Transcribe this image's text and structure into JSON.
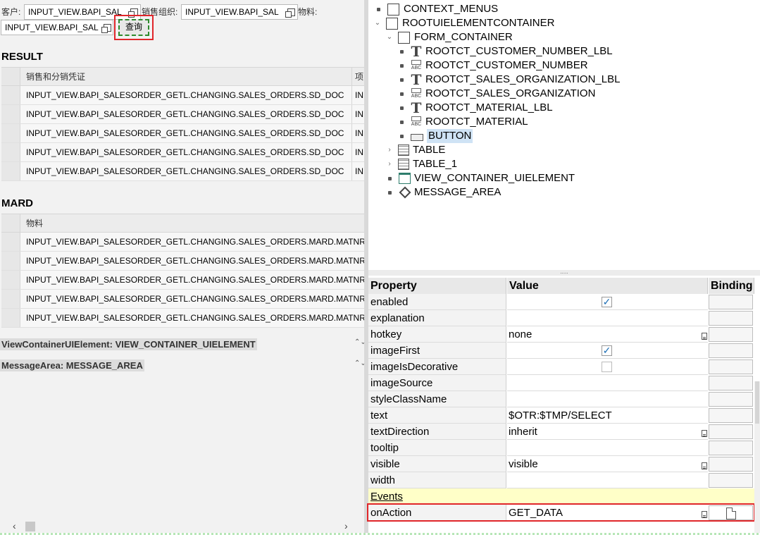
{
  "form": {
    "customer_label": "客户:",
    "customer_value": "INPUT_VIEW.BAPI_SAL",
    "salesorg_label": "销售组织:",
    "salesorg_value": "INPUT_VIEW.BAPI_SAL",
    "material_label": "物料:",
    "material_value": "INPUT_VIEW.BAPI_SAL",
    "query_button": "查询"
  },
  "result_table": {
    "title": "RESULT",
    "columns": [
      "销售和分销凭证",
      "项"
    ],
    "rows": [
      [
        "INPUT_VIEW.BAPI_SALESORDER_GETL.CHANGING.SALES_ORDERS.SD_DOC",
        "IN"
      ],
      [
        "INPUT_VIEW.BAPI_SALESORDER_GETL.CHANGING.SALES_ORDERS.SD_DOC",
        "IN"
      ],
      [
        "INPUT_VIEW.BAPI_SALESORDER_GETL.CHANGING.SALES_ORDERS.SD_DOC",
        "IN"
      ],
      [
        "INPUT_VIEW.BAPI_SALESORDER_GETL.CHANGING.SALES_ORDERS.SD_DOC",
        "IN"
      ],
      [
        "INPUT_VIEW.BAPI_SALESORDER_GETL.CHANGING.SALES_ORDERS.SD_DOC",
        "IN"
      ]
    ]
  },
  "mard_table": {
    "title": "MARD",
    "columns": [
      "物料"
    ],
    "rows": [
      "INPUT_VIEW.BAPI_SALESORDER_GETL.CHANGING.SALES_ORDERS.MARD.MATNR",
      "INPUT_VIEW.BAPI_SALESORDER_GETL.CHANGING.SALES_ORDERS.MARD.MATNR",
      "INPUT_VIEW.BAPI_SALESORDER_GETL.CHANGING.SALES_ORDERS.MARD.MATNR",
      "INPUT_VIEW.BAPI_SALESORDER_GETL.CHANGING.SALES_ORDERS.MARD.MATNR",
      "INPUT_VIEW.BAPI_SALESORDER_GETL.CHANGING.SALES_ORDERS.MARD.MATNR"
    ]
  },
  "placeholders": {
    "view_container": "ViewContainerUIElement: VIEW_CONTAINER_UIELEMENT",
    "message_area": "MessageArea: MESSAGE_AREA"
  },
  "tree": {
    "context_menus": "CONTEXT_MENUS",
    "root": "ROOTUIELEMENTCONTAINER",
    "form_container": "FORM_CONTAINER",
    "form_children": [
      {
        "label": "ROOTCT_CUSTOMER_NUMBER_LBL",
        "icon": "label-icon"
      },
      {
        "label": "ROOTCT_CUSTOMER_NUMBER",
        "icon": "inputfield-icon"
      },
      {
        "label": "ROOTCT_SALES_ORGANIZATION_LBL",
        "icon": "label-icon"
      },
      {
        "label": "ROOTCT_SALES_ORGANIZATION",
        "icon": "inputfield-icon"
      },
      {
        "label": "ROOTCT_MATERIAL_LBL",
        "icon": "label-icon"
      },
      {
        "label": "ROOTCT_MATERIAL",
        "icon": "inputfield-icon"
      },
      {
        "label": "BUTTON",
        "icon": "button-icon",
        "selected": true
      }
    ],
    "table": "TABLE",
    "table_1": "TABLE_1",
    "view_container": "VIEW_CONTAINER_UIELEMENT",
    "message_area": "MESSAGE_AREA"
  },
  "properties": {
    "headers": {
      "property": "Property",
      "value": "Value",
      "binding": "Binding"
    },
    "rows": [
      {
        "name": "enabled",
        "type": "checkbox",
        "checked": true
      },
      {
        "name": "explanation",
        "value": ""
      },
      {
        "name": "hotkey",
        "value": "none",
        "dropdown": true
      },
      {
        "name": "imageFirst",
        "type": "checkbox",
        "checked": true
      },
      {
        "name": "imageIsDecorative",
        "type": "checkbox",
        "checked": false
      },
      {
        "name": "imageSource",
        "value": ""
      },
      {
        "name": "styleClassName",
        "value": ""
      },
      {
        "name": "text",
        "value": "$OTR:$TMP/SELECT"
      },
      {
        "name": "textDirection",
        "value": "inherit",
        "dropdown": true
      },
      {
        "name": "tooltip",
        "value": ""
      },
      {
        "name": "visible",
        "value": "visible",
        "dropdown": true
      },
      {
        "name": "width",
        "value": ""
      }
    ],
    "events_label": "Events",
    "event": {
      "name": "onAction",
      "value": "GET_DATA"
    }
  },
  "colors": {
    "highlight_frame": "#e0262a",
    "focus_dash": "#2e8a2e",
    "tree_selection": "#cfe3f5",
    "events_background": "#ffffc8",
    "checkbox_tick": "#1e6fb5"
  }
}
